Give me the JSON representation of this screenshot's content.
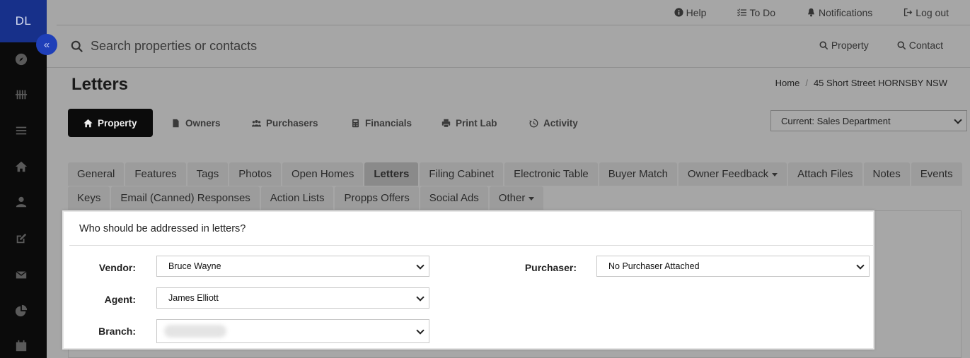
{
  "user": {
    "initials": "DL"
  },
  "topbar": {
    "help": "Help",
    "todo": "To Do",
    "notifications": "Notifications",
    "logout": "Log out"
  },
  "search": {
    "placeholder": "Search properties or contacts",
    "property": "Property",
    "contact": "Contact"
  },
  "page": {
    "title": "Letters"
  },
  "breadcrumb": {
    "home": "Home",
    "separator": "/",
    "current": "45 Short Street HORNSBY NSW"
  },
  "main_tabs": [
    {
      "label": "Property",
      "icon": "home-icon",
      "active": true
    },
    {
      "label": "Owners",
      "icon": "file-icon"
    },
    {
      "label": "Purchasers",
      "icon": "users-icon"
    },
    {
      "label": "Financials",
      "icon": "calculator-icon"
    },
    {
      "label": "Print Lab",
      "icon": "printer-icon"
    },
    {
      "label": "Activity",
      "icon": "history-icon"
    }
  ],
  "department": {
    "selected": "Current: Sales Department"
  },
  "sub_tabs_row1": [
    "General",
    "Features",
    "Tags",
    "Photos",
    "Open Homes",
    "Letters",
    "Filing Cabinet",
    "Electronic Table",
    "Buyer Match",
    "Owner Feedback",
    "Attach Files",
    "Notes",
    "Events"
  ],
  "sub_tabs_row2": [
    "Keys",
    "Email (Canned) Responses",
    "Action Lists",
    "Propps Offers",
    "Social Ads",
    "Other"
  ],
  "active_sub_tab": "Letters",
  "letters_form": {
    "heading": "Who should be addressed in letters?",
    "vendor_label": "Vendor:",
    "vendor_value": "Bruce Wayne",
    "agent_label": "Agent:",
    "agent_value": "James Elliott",
    "branch_label": "Branch:",
    "purchaser_label": "Purchaser:",
    "purchaser_value": "No Purchaser Attached"
  },
  "colors": {
    "sidebar": "#0b0b0b",
    "avatar_bg": "#17308a",
    "collapse_button": "#1f3fb8",
    "active_tab": "#0b0b0b"
  }
}
